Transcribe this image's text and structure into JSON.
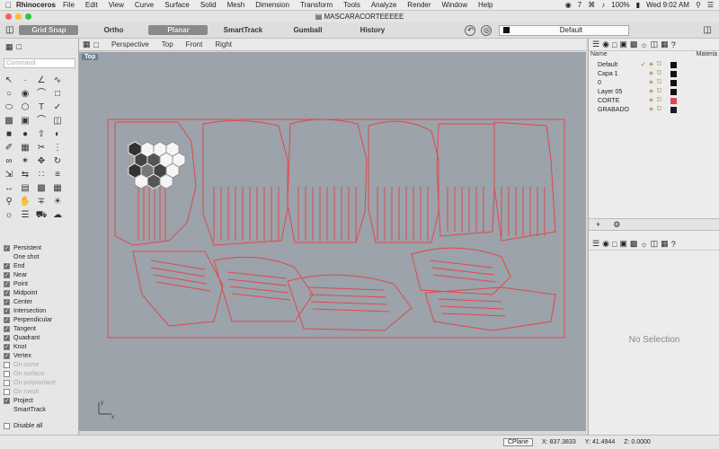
{
  "menubar": {
    "app": "Rhinoceros",
    "items": [
      "File",
      "Edit",
      "View",
      "Curve",
      "Surface",
      "Solid",
      "Mesh",
      "Dimension",
      "Transform",
      "Tools",
      "Analyze",
      "Render",
      "Window",
      "Help"
    ],
    "right": {
      "num": "7",
      "battery": "100%",
      "clock": "Wed 9:02 AM"
    }
  },
  "window": {
    "title": "MASCARACORTEEEEE"
  },
  "toolbar": {
    "grid_snap": "Grid Snap",
    "ortho": "Ortho",
    "planar": "Planar",
    "smarttrack": "SmartTrack",
    "gumball": "Gumball",
    "history": "History",
    "current_layer": "Default"
  },
  "sidebar": {
    "command_placeholder": "Command"
  },
  "snaps": [
    {
      "label": "Persistent",
      "checked": true,
      "cb": true
    },
    {
      "label": "One shot",
      "checked": false,
      "cb": false
    },
    {
      "label": "End",
      "checked": true,
      "cb": true
    },
    {
      "label": "Near",
      "checked": true,
      "cb": true
    },
    {
      "label": "Point",
      "checked": true,
      "cb": true
    },
    {
      "label": "Midpoint",
      "checked": true,
      "cb": true
    },
    {
      "label": "Center",
      "checked": true,
      "cb": true
    },
    {
      "label": "Intersection",
      "checked": true,
      "cb": true
    },
    {
      "label": "Perpendicular",
      "checked": true,
      "cb": true
    },
    {
      "label": "Tangent",
      "checked": true,
      "cb": true
    },
    {
      "label": "Quadrant",
      "checked": true,
      "cb": true
    },
    {
      "label": "Knot",
      "checked": true,
      "cb": true
    },
    {
      "label": "Vertex",
      "checked": true,
      "cb": true
    },
    {
      "label": "On curve",
      "checked": false,
      "cb": true,
      "dim": true
    },
    {
      "label": "On surface",
      "checked": false,
      "cb": true,
      "dim": true
    },
    {
      "label": "On polysurface",
      "checked": false,
      "cb": true,
      "dim": true
    },
    {
      "label": "On mesh",
      "checked": false,
      "cb": true,
      "dim": true
    },
    {
      "label": "Project",
      "checked": true,
      "cb": true
    },
    {
      "label": "SmartTrack",
      "checked": false,
      "cb": false
    },
    {
      "label": "Disable all",
      "checked": false,
      "cb": true
    }
  ],
  "viewport": {
    "tabs": [
      "Perspective",
      "Top",
      "Front",
      "Right"
    ],
    "active": "Top",
    "label": "Top",
    "axis_x": "x",
    "axis_y": "y",
    "curve_color": "#e0484c"
  },
  "layers": {
    "header_name": "Name",
    "header_material": "Materia",
    "rows": [
      {
        "name": "Default",
        "color": "#111111"
      },
      {
        "name": "Capa 1",
        "color": "#111111"
      },
      {
        "name": "0",
        "color": "#111111"
      },
      {
        "name": "Layer 05",
        "color": "#111111"
      },
      {
        "name": "CORTE",
        "color": "#e0484c"
      },
      {
        "name": "GRABADO",
        "color": "#1a1a2a"
      }
    ]
  },
  "properties": {
    "empty_text": "No Selection"
  },
  "status": {
    "cplane": "CPlane",
    "x": "X: 837.3833",
    "y": "Y: 41.4944",
    "z": "Z: 0.0000"
  }
}
